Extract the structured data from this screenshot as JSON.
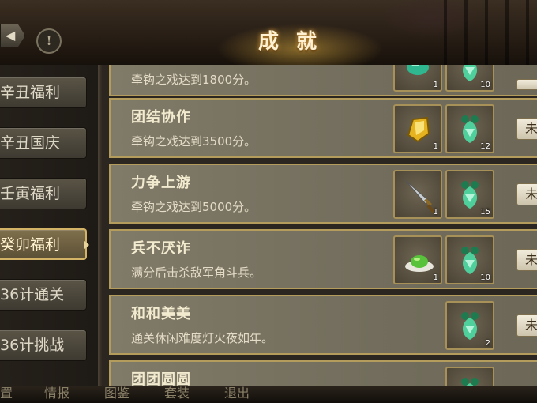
{
  "header": {
    "title": "成就",
    "info_icon": "info-icon",
    "back_icon": "back-arrow-icon"
  },
  "sidebar": {
    "items": [
      {
        "label": "辛丑福利"
      },
      {
        "label": "辛丑国庆"
      },
      {
        "label": "壬寅福利"
      },
      {
        "label": "癸卯福利",
        "active": true
      },
      {
        "label": "36计通关"
      },
      {
        "label": "36计挑战"
      }
    ]
  },
  "achievements": [
    {
      "title": "",
      "desc": "牵钩之戏达到1800分。",
      "rewards": [
        {
          "icon": "green-jade-icon",
          "qty": "1"
        },
        {
          "icon": "jade-ornament-icon",
          "qty": "10"
        }
      ],
      "status": ""
    },
    {
      "title": "团结协作",
      "desc": "牵钩之戏达到3500分。",
      "rewards": [
        {
          "icon": "gold-ingot-icon",
          "qty": "1"
        },
        {
          "icon": "jade-ornament-icon",
          "qty": "12"
        }
      ],
      "status": "未"
    },
    {
      "title": "力争上游",
      "desc": "牵钩之戏达到5000分。",
      "rewards": [
        {
          "icon": "sword-icon",
          "qty": "1"
        },
        {
          "icon": "jade-ornament-icon",
          "qty": "15"
        }
      ],
      "status": "未"
    },
    {
      "title": "兵不厌诈",
      "desc": "满分后击杀敌军角斗兵。",
      "rewards": [
        {
          "icon": "green-bean-dish-icon",
          "qty": "1"
        },
        {
          "icon": "jade-ornament-icon",
          "qty": "10"
        }
      ],
      "status": "未"
    },
    {
      "title": "和和美美",
      "desc": "通关休闲难度灯火夜如年。",
      "rewards": [
        {
          "icon": "jade-ornament-icon",
          "qty": "2"
        }
      ],
      "status": "未"
    },
    {
      "title": "团团圆圆",
      "desc": "",
      "rewards": [
        {
          "icon": "jade-ornament-icon",
          "qty": ""
        }
      ],
      "status": ""
    }
  ],
  "bottom_bar": {
    "items": [
      "置",
      "情报",
      "图鉴",
      "套装",
      "退出"
    ]
  },
  "colors": {
    "accent_gold": "#d3b467",
    "panel": "#7a7563",
    "text_light": "#f3ebcf"
  }
}
